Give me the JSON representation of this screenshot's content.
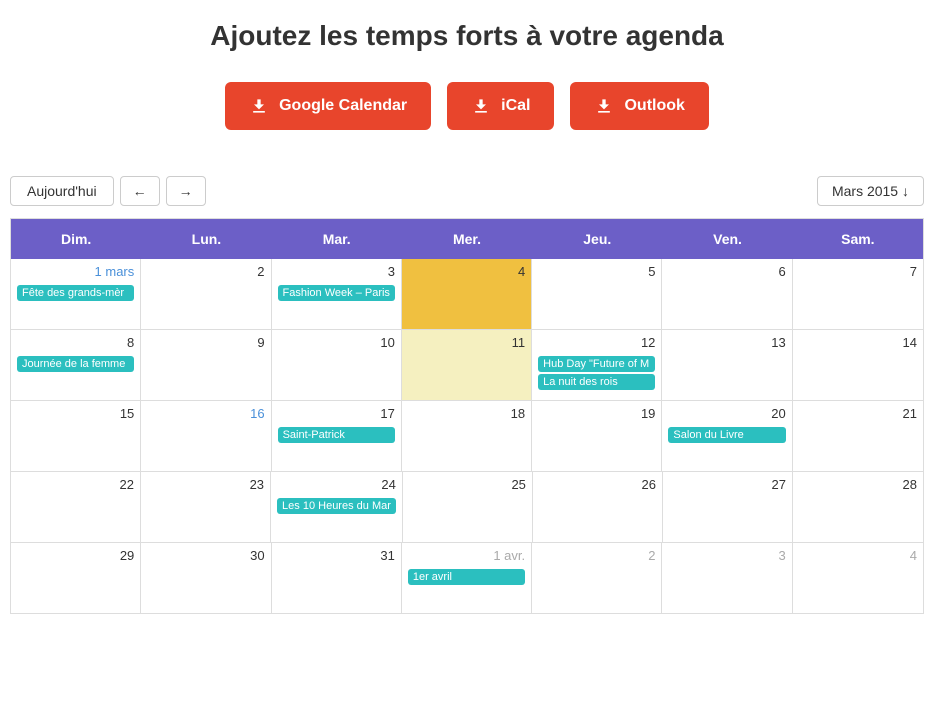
{
  "header": {
    "title": "Ajoutez les temps forts à votre agenda"
  },
  "buttons": [
    {
      "id": "google",
      "label": "Google Calendar",
      "icon": "download"
    },
    {
      "id": "ical",
      "label": "iCal",
      "icon": "download"
    },
    {
      "id": "outlook",
      "label": "Outlook",
      "icon": "download"
    }
  ],
  "nav": {
    "today_label": "Aujourd'hui",
    "prev_label": "←",
    "next_label": "→",
    "month_label": "Mars 2015 ↓"
  },
  "calendar": {
    "headers": [
      "Dim.",
      "Lun.",
      "Mar.",
      "Mer.",
      "Jeu.",
      "Ven.",
      "Sam."
    ],
    "weeks": [
      {
        "days": [
          {
            "num": "1 mars",
            "numClass": "blue",
            "events": [
              {
                "label": "Fête des grands-mèr",
                "color": "teal"
              }
            ],
            "bg": ""
          },
          {
            "num": "2",
            "numClass": "",
            "events": [],
            "bg": ""
          },
          {
            "num": "3",
            "numClass": "",
            "events": [
              {
                "label": "Fashion Week – Paris",
                "color": "teal"
              }
            ],
            "bg": ""
          },
          {
            "num": "4",
            "numClass": "",
            "events": [],
            "bg": "gold"
          },
          {
            "num": "5",
            "numClass": "",
            "events": [],
            "bg": ""
          },
          {
            "num": "6",
            "numClass": "",
            "events": [],
            "bg": ""
          },
          {
            "num": "7",
            "numClass": "",
            "events": [],
            "bg": ""
          }
        ]
      },
      {
        "days": [
          {
            "num": "8",
            "numClass": "",
            "events": [
              {
                "label": "Journée de la femme",
                "color": "teal"
              }
            ],
            "bg": ""
          },
          {
            "num": "9",
            "numClass": "",
            "events": [],
            "bg": ""
          },
          {
            "num": "10",
            "numClass": "",
            "events": [],
            "bg": ""
          },
          {
            "num": "11",
            "numClass": "",
            "events": [],
            "bg": "highlight"
          },
          {
            "num": "12",
            "numClass": "",
            "events": [
              {
                "label": "Hub Day \"Future of M",
                "color": "teal"
              },
              {
                "label": "La nuit des rois",
                "color": "teal"
              }
            ],
            "bg": ""
          },
          {
            "num": "13",
            "numClass": "",
            "events": [],
            "bg": ""
          },
          {
            "num": "14",
            "numClass": "",
            "events": [],
            "bg": ""
          }
        ]
      },
      {
        "days": [
          {
            "num": "15",
            "numClass": "",
            "events": [],
            "bg": ""
          },
          {
            "num": "16",
            "numClass": "blue",
            "events": [],
            "bg": ""
          },
          {
            "num": "17",
            "numClass": "",
            "events": [
              {
                "label": "Saint-Patrick",
                "color": "teal"
              }
            ],
            "bg": ""
          },
          {
            "num": "18",
            "numClass": "",
            "events": [],
            "bg": ""
          },
          {
            "num": "19",
            "numClass": "",
            "events": [],
            "bg": ""
          },
          {
            "num": "20",
            "numClass": "",
            "events": [
              {
                "label": "Salon du Livre",
                "color": "teal"
              }
            ],
            "bg": ""
          },
          {
            "num": "21",
            "numClass": "",
            "events": [],
            "bg": ""
          }
        ]
      },
      {
        "days": [
          {
            "num": "22",
            "numClass": "",
            "events": [],
            "bg": ""
          },
          {
            "num": "23",
            "numClass": "",
            "events": [],
            "bg": ""
          },
          {
            "num": "24",
            "numClass": "",
            "events": [
              {
                "label": "Les 10 Heures du Mar",
                "color": "teal"
              }
            ],
            "bg": ""
          },
          {
            "num": "25",
            "numClass": "",
            "events": [],
            "bg": ""
          },
          {
            "num": "26",
            "numClass": "",
            "events": [],
            "bg": ""
          },
          {
            "num": "27",
            "numClass": "",
            "events": [],
            "bg": ""
          },
          {
            "num": "28",
            "numClass": "",
            "events": [],
            "bg": ""
          }
        ]
      },
      {
        "days": [
          {
            "num": "29",
            "numClass": "",
            "events": [],
            "bg": ""
          },
          {
            "num": "30",
            "numClass": "",
            "events": [],
            "bg": ""
          },
          {
            "num": "31",
            "numClass": "",
            "events": [],
            "bg": ""
          },
          {
            "num": "1 avr.",
            "numClass": "gray",
            "events": [
              {
                "label": "1er avril",
                "color": "teal"
              }
            ],
            "bg": ""
          },
          {
            "num": "2",
            "numClass": "gray",
            "events": [],
            "bg": ""
          },
          {
            "num": "3",
            "numClass": "gray",
            "events": [],
            "bg": ""
          },
          {
            "num": "4",
            "numClass": "gray",
            "events": [],
            "bg": ""
          }
        ]
      }
    ]
  }
}
